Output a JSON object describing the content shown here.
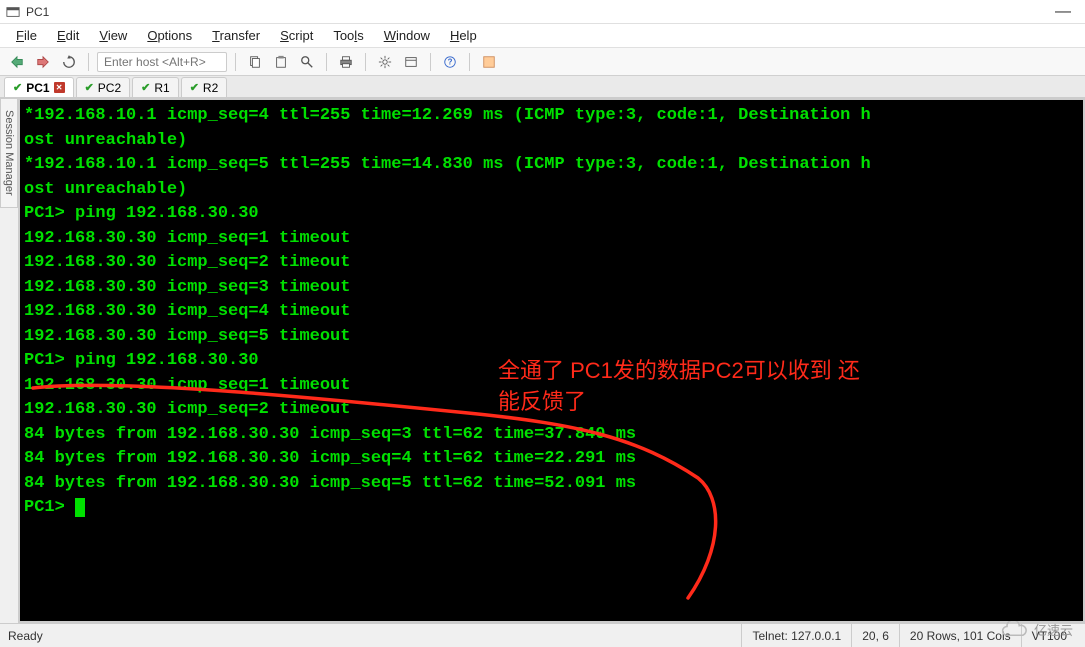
{
  "window": {
    "title": "PC1"
  },
  "menu": {
    "file": "File",
    "edit": "Edit",
    "view": "View",
    "options": "Options",
    "transfer": "Transfer",
    "script": "Script",
    "tools": "Tools",
    "window": "Window",
    "help": "Help"
  },
  "toolbar": {
    "host_placeholder": "Enter host <Alt+R>"
  },
  "tabs": [
    {
      "label": "PC1",
      "ok": true,
      "active": true,
      "closeable": true
    },
    {
      "label": "PC2",
      "ok": true,
      "active": false,
      "closeable": false
    },
    {
      "label": "R1",
      "ok": true,
      "active": false,
      "closeable": false
    },
    {
      "label": "R2",
      "ok": true,
      "active": false,
      "closeable": false
    }
  ],
  "sidebar": {
    "label": "Session Manager"
  },
  "terminal": {
    "lines": [
      "*192.168.10.1 icmp_seq=4 ttl=255 time=12.269 ms (ICMP type:3, code:1, Destination h",
      "ost unreachable)",
      "*192.168.10.1 icmp_seq=5 ttl=255 time=14.830 ms (ICMP type:3, code:1, Destination h",
      "ost unreachable)",
      "",
      "PC1> ping 192.168.30.30",
      "192.168.30.30 icmp_seq=1 timeout",
      "192.168.30.30 icmp_seq=2 timeout",
      "192.168.30.30 icmp_seq=3 timeout",
      "192.168.30.30 icmp_seq=4 timeout",
      "192.168.30.30 icmp_seq=5 timeout",
      "",
      "PC1> ping 192.168.30.30",
      "192.168.30.30 icmp_seq=1 timeout",
      "192.168.30.30 icmp_seq=2 timeout",
      "84 bytes from 192.168.30.30 icmp_seq=3 ttl=62 time=37.840 ms",
      "84 bytes from 192.168.30.30 icmp_seq=4 ttl=62 time=22.291 ms",
      "84 bytes from 192.168.30.30 icmp_seq=5 ttl=62 time=52.091 ms",
      "",
      "PC1> "
    ],
    "prompt_has_cursor": true
  },
  "annotation": {
    "line1": "全通了 PC1发的数据PC2可以收到 还",
    "line2": "能反馈了"
  },
  "status": {
    "ready": "Ready",
    "conn": "Telnet: 127.0.0.1",
    "pos": "20,  6",
    "size": "20 Rows, 101 Cols",
    "term": "VT100"
  },
  "watermark": {
    "text": "亿速云"
  }
}
